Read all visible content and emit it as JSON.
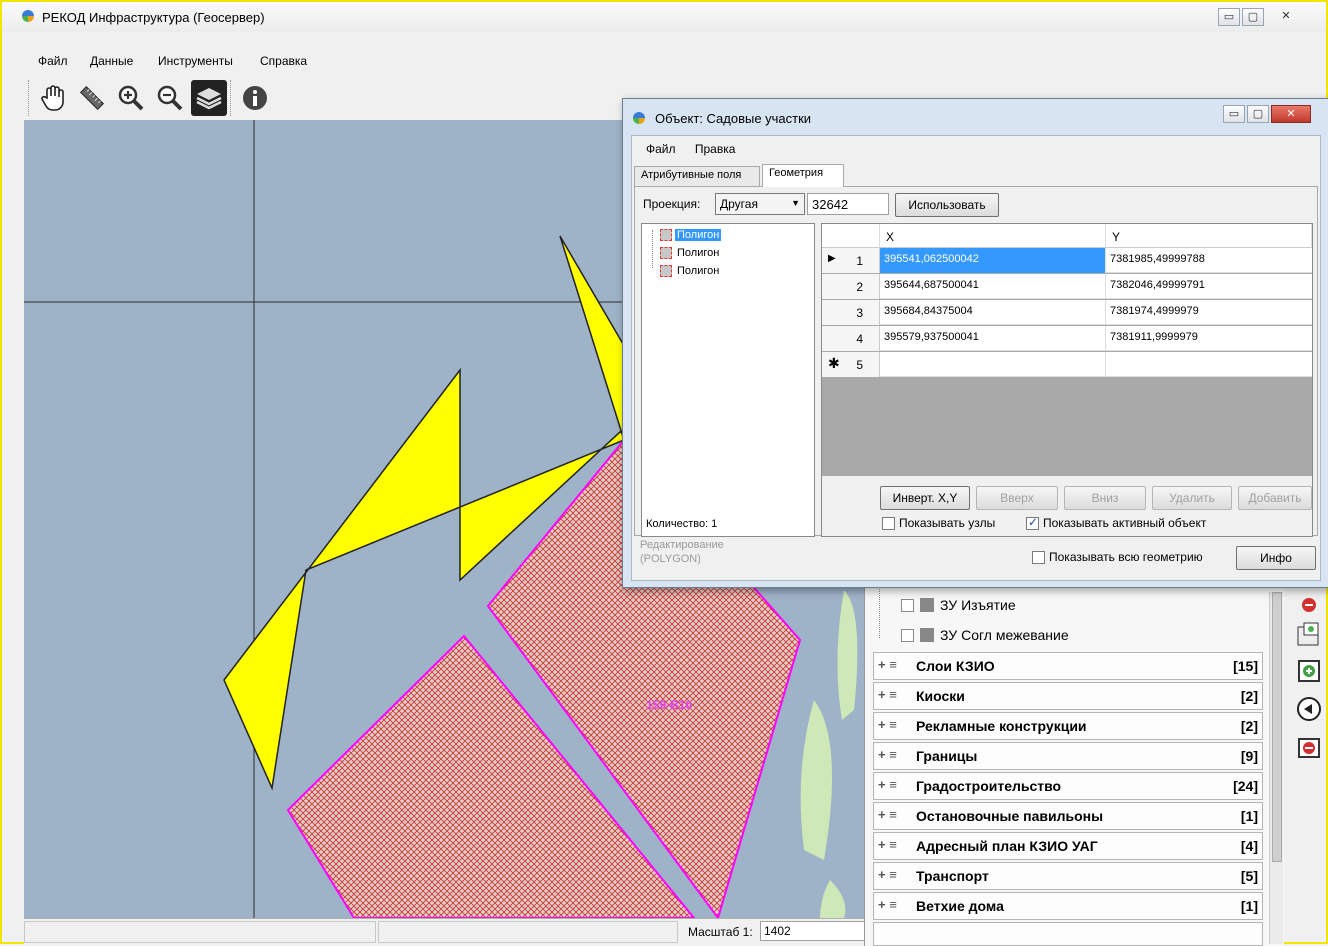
{
  "main_window": {
    "title": "РЕКОД Инфраструктура (Геосервер)",
    "menu": [
      "Файл",
      "Данные",
      "Инструменты",
      "Справка"
    ],
    "toolbar_icons": [
      "hand-pan-icon",
      "ruler-icon",
      "zoom-in-icon",
      "zoom-out-icon",
      "layers-icon",
      "info-icon"
    ]
  },
  "map": {
    "label": "159-В10",
    "colors": {
      "background": "#9fb3c8",
      "polygon_fill": "#ffff00",
      "parcel_outline": "#ff00ff",
      "parcel_hatch": "#c0392b"
    }
  },
  "status_bar": {
    "scale_label": "Масштаб 1:",
    "scale_value": "1402"
  },
  "dialog": {
    "title": "Объект: Садовые участки",
    "menu": [
      "Файл",
      "Правка"
    ],
    "tabs": [
      {
        "label": "Атрибутивные поля"
      },
      {
        "label": "Геометрия",
        "active": true
      }
    ],
    "projection_label": "Проекция:",
    "projection_value": "Другая",
    "projection_code": "32642",
    "use_button": "Использовать",
    "tree": [
      "Полигон",
      "Полигон",
      "Полигон"
    ],
    "count_label": "Количество: 1",
    "grid": {
      "columns": [
        "X",
        "Y"
      ],
      "rows": [
        {
          "num": "1",
          "x": "395541,062500042",
          "y": "7381985,49999788"
        },
        {
          "num": "2",
          "x": "395644,687500041",
          "y": "7382046,49999791"
        },
        {
          "num": "3",
          "x": "395684,84375004",
          "y": "7381974,4999979"
        },
        {
          "num": "4",
          "x": "395579,937500041",
          "y": "7381911,9999979"
        },
        {
          "num": "5",
          "x": "",
          "y": ""
        }
      ]
    },
    "buttons": {
      "invert": "Инверт. X,Y",
      "up": "Вверх",
      "down": "Вниз",
      "delete": "Удалить",
      "add": "Добавить",
      "info": "Инфо"
    },
    "show_nodes": "Показывать узлы",
    "show_active": "Показывать активный объект",
    "show_all": "Показывать всю геометрию",
    "edit_label": "Редактирование",
    "edit_type": "(POLYGON)"
  },
  "layers": {
    "sub_items": [
      "ЗУ Изъятие",
      "ЗУ Согл межевание"
    ],
    "groups": [
      {
        "name": "Слои КЗИО",
        "count": "[15]"
      },
      {
        "name": "Киоски",
        "count": "[2]"
      },
      {
        "name": "Рекламные конструкции",
        "count": "[2]"
      },
      {
        "name": "Границы",
        "count": "[9]"
      },
      {
        "name": "Градостроительство",
        "count": "[24]"
      },
      {
        "name": "Остановочные павильоны",
        "count": "[1]"
      },
      {
        "name": "Адресный план КЗИО УАГ",
        "count": "[4]"
      },
      {
        "name": "Транспорт",
        "count": "[5]"
      },
      {
        "name": "Ветхие дома",
        "count": "[1]"
      }
    ]
  }
}
